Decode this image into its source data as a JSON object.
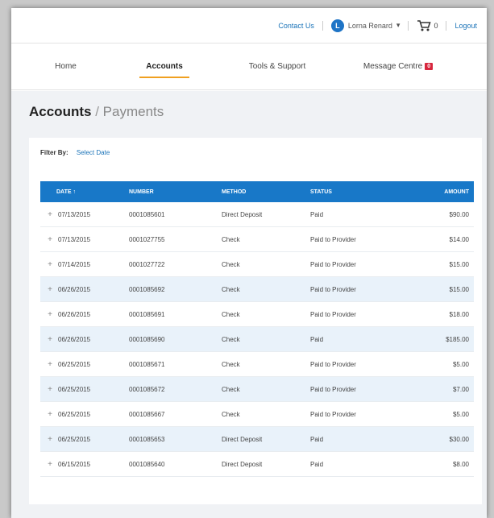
{
  "topbar": {
    "contact": "Contact Us",
    "user_initial": "L",
    "user_name": "Lorna Renard",
    "cart_count": "0",
    "logout": "Logout"
  },
  "nav": {
    "items": [
      {
        "label": "Home"
      },
      {
        "label": "Accounts"
      },
      {
        "label": "Tools & Support"
      },
      {
        "label": "Message Centre"
      }
    ],
    "badge": "0"
  },
  "page": {
    "title_main": "Accounts",
    "slash": "/",
    "title_sub": "Payments"
  },
  "filter": {
    "label": "Filter By:",
    "link": "Select Date"
  },
  "table": {
    "headers": {
      "date": "DATE ↑",
      "number": "NUMBER",
      "method": "METHOD",
      "status": "STATUS",
      "amount": "AMOUNT"
    },
    "rows": [
      {
        "date": "07/13/2015",
        "number": "0001085601",
        "method": "Direct Deposit",
        "status": "Paid",
        "amount": "$90.00"
      },
      {
        "date": "07/13/2015",
        "number": "0001027755",
        "method": "Check",
        "status": "Paid to Provider",
        "amount": "$14.00"
      },
      {
        "date": "07/14/2015",
        "number": "0001027722",
        "method": "Check",
        "status": "Paid to Provider",
        "amount": "$15.00"
      },
      {
        "date": "06/26/2015",
        "number": "0001085692",
        "method": "Check",
        "status": "Paid to Provider",
        "amount": "$15.00"
      },
      {
        "date": "06/26/2015",
        "number": "0001085691",
        "method": "Check",
        "status": "Paid to Provider",
        "amount": "$18.00"
      },
      {
        "date": "06/26/2015",
        "number": "0001085690",
        "method": "Check",
        "status": "Paid",
        "amount": "$185.00"
      },
      {
        "date": "06/25/2015",
        "number": "0001085671",
        "method": "Check",
        "status": "Paid to Provider",
        "amount": "$5.00"
      },
      {
        "date": "06/25/2015",
        "number": "0001085672",
        "method": "Check",
        "status": "Paid to Provider",
        "amount": "$7.00"
      },
      {
        "date": "06/25/2015",
        "number": "0001085667",
        "method": "Check",
        "status": "Paid to Provider",
        "amount": "$5.00"
      },
      {
        "date": "06/25/2015",
        "number": "0001085653",
        "method": "Direct Deposit",
        "status": "Paid",
        "amount": "$30.00"
      },
      {
        "date": "06/15/2015",
        "number": "0001085640",
        "method": "Direct Deposit",
        "status": "Paid",
        "amount": "$8.00"
      }
    ]
  },
  "colors": {
    "header_blue": "#1878c8",
    "accent_orange": "#f0a020",
    "link_blue": "#1a73b8",
    "badge_red": "#d7263d",
    "row_alt": "#e9f2fa"
  }
}
